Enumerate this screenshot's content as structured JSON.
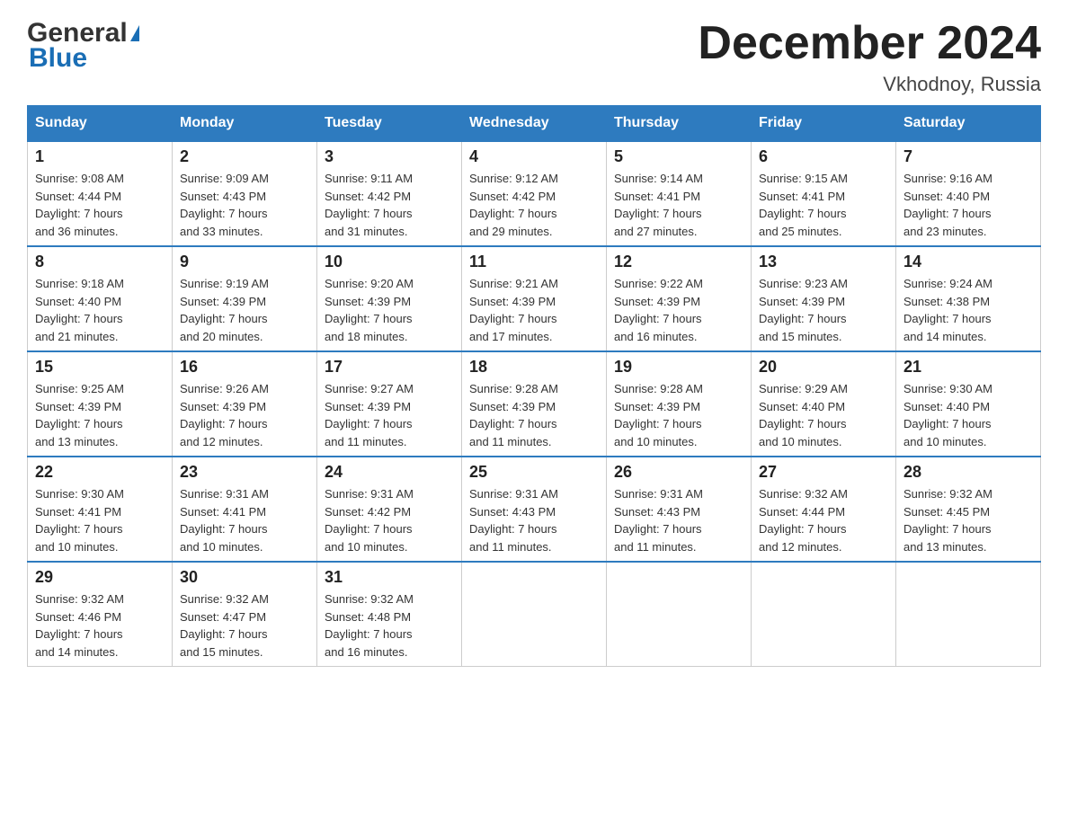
{
  "header": {
    "logo_line1": "General",
    "logo_line2": "Blue",
    "month_title": "December 2024",
    "location": "Vkhodnoy, Russia"
  },
  "days_of_week": [
    "Sunday",
    "Monday",
    "Tuesday",
    "Wednesday",
    "Thursday",
    "Friday",
    "Saturday"
  ],
  "weeks": [
    [
      {
        "day": "1",
        "sunrise": "9:08 AM",
        "sunset": "4:44 PM",
        "daylight": "7 hours and 36 minutes."
      },
      {
        "day": "2",
        "sunrise": "9:09 AM",
        "sunset": "4:43 PM",
        "daylight": "7 hours and 33 minutes."
      },
      {
        "day": "3",
        "sunrise": "9:11 AM",
        "sunset": "4:42 PM",
        "daylight": "7 hours and 31 minutes."
      },
      {
        "day": "4",
        "sunrise": "9:12 AM",
        "sunset": "4:42 PM",
        "daylight": "7 hours and 29 minutes."
      },
      {
        "day": "5",
        "sunrise": "9:14 AM",
        "sunset": "4:41 PM",
        "daylight": "7 hours and 27 minutes."
      },
      {
        "day": "6",
        "sunrise": "9:15 AM",
        "sunset": "4:41 PM",
        "daylight": "7 hours and 25 minutes."
      },
      {
        "day": "7",
        "sunrise": "9:16 AM",
        "sunset": "4:40 PM",
        "daylight": "7 hours and 23 minutes."
      }
    ],
    [
      {
        "day": "8",
        "sunrise": "9:18 AM",
        "sunset": "4:40 PM",
        "daylight": "7 hours and 21 minutes."
      },
      {
        "day": "9",
        "sunrise": "9:19 AM",
        "sunset": "4:39 PM",
        "daylight": "7 hours and 20 minutes."
      },
      {
        "day": "10",
        "sunrise": "9:20 AM",
        "sunset": "4:39 PM",
        "daylight": "7 hours and 18 minutes."
      },
      {
        "day": "11",
        "sunrise": "9:21 AM",
        "sunset": "4:39 PM",
        "daylight": "7 hours and 17 minutes."
      },
      {
        "day": "12",
        "sunrise": "9:22 AM",
        "sunset": "4:39 PM",
        "daylight": "7 hours and 16 minutes."
      },
      {
        "day": "13",
        "sunrise": "9:23 AM",
        "sunset": "4:39 PM",
        "daylight": "7 hours and 15 minutes."
      },
      {
        "day": "14",
        "sunrise": "9:24 AM",
        "sunset": "4:38 PM",
        "daylight": "7 hours and 14 minutes."
      }
    ],
    [
      {
        "day": "15",
        "sunrise": "9:25 AM",
        "sunset": "4:39 PM",
        "daylight": "7 hours and 13 minutes."
      },
      {
        "day": "16",
        "sunrise": "9:26 AM",
        "sunset": "4:39 PM",
        "daylight": "7 hours and 12 minutes."
      },
      {
        "day": "17",
        "sunrise": "9:27 AM",
        "sunset": "4:39 PM",
        "daylight": "7 hours and 11 minutes."
      },
      {
        "day": "18",
        "sunrise": "9:28 AM",
        "sunset": "4:39 PM",
        "daylight": "7 hours and 11 minutes."
      },
      {
        "day": "19",
        "sunrise": "9:28 AM",
        "sunset": "4:39 PM",
        "daylight": "7 hours and 10 minutes."
      },
      {
        "day": "20",
        "sunrise": "9:29 AM",
        "sunset": "4:40 PM",
        "daylight": "7 hours and 10 minutes."
      },
      {
        "day": "21",
        "sunrise": "9:30 AM",
        "sunset": "4:40 PM",
        "daylight": "7 hours and 10 minutes."
      }
    ],
    [
      {
        "day": "22",
        "sunrise": "9:30 AM",
        "sunset": "4:41 PM",
        "daylight": "7 hours and 10 minutes."
      },
      {
        "day": "23",
        "sunrise": "9:31 AM",
        "sunset": "4:41 PM",
        "daylight": "7 hours and 10 minutes."
      },
      {
        "day": "24",
        "sunrise": "9:31 AM",
        "sunset": "4:42 PM",
        "daylight": "7 hours and 10 minutes."
      },
      {
        "day": "25",
        "sunrise": "9:31 AM",
        "sunset": "4:43 PM",
        "daylight": "7 hours and 11 minutes."
      },
      {
        "day": "26",
        "sunrise": "9:31 AM",
        "sunset": "4:43 PM",
        "daylight": "7 hours and 11 minutes."
      },
      {
        "day": "27",
        "sunrise": "9:32 AM",
        "sunset": "4:44 PM",
        "daylight": "7 hours and 12 minutes."
      },
      {
        "day": "28",
        "sunrise": "9:32 AM",
        "sunset": "4:45 PM",
        "daylight": "7 hours and 13 minutes."
      }
    ],
    [
      {
        "day": "29",
        "sunrise": "9:32 AM",
        "sunset": "4:46 PM",
        "daylight": "7 hours and 14 minutes."
      },
      {
        "day": "30",
        "sunrise": "9:32 AM",
        "sunset": "4:47 PM",
        "daylight": "7 hours and 15 minutes."
      },
      {
        "day": "31",
        "sunrise": "9:32 AM",
        "sunset": "4:48 PM",
        "daylight": "7 hours and 16 minutes."
      },
      null,
      null,
      null,
      null
    ]
  ],
  "labels": {
    "sunrise": "Sunrise:",
    "sunset": "Sunset:",
    "daylight": "Daylight:"
  }
}
